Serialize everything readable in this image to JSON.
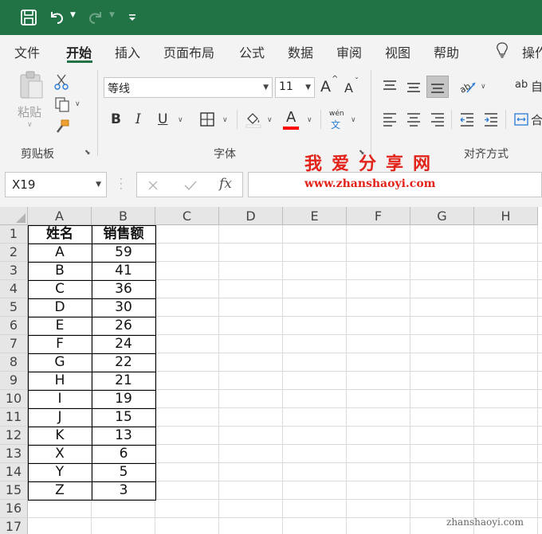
{
  "quick_access": {
    "icons": [
      "save-icon",
      "undo-icon",
      "redo-icon",
      "customize-qat-icon"
    ]
  },
  "ribbon_tabs": [
    "文件",
    "开始",
    "插入",
    "页面布局",
    "公式",
    "数据",
    "审阅",
    "视图",
    "帮助",
    "操作"
  ],
  "active_tab": "开始",
  "ribbon": {
    "clipboard": {
      "paste_label": "粘贴",
      "group_label": "剪贴板"
    },
    "font": {
      "font_name": "等线",
      "font_size": "11",
      "grow_label": "A",
      "shrink_label": "A",
      "bold": "B",
      "italic": "I",
      "underline": "U",
      "font_color_label": "A",
      "phonetic_top": "wén",
      "phonetic_bottom": "文",
      "group_label": "字体",
      "font_color": "#ff0000"
    },
    "alignment": {
      "wrap_label": "自",
      "merge_label": "合",
      "phonetic_ab": "ab",
      "group_label": "对齐方式"
    }
  },
  "formula_bar": {
    "name_box": "X19",
    "fx_label": "fx",
    "formula": ""
  },
  "watermark": {
    "title": "我爱分享网",
    "url": "www.zhanshaoyi.com",
    "footer": "zhanshaoyi.com"
  },
  "sheet": {
    "columns": [
      "A",
      "B",
      "C",
      "D",
      "E",
      "F",
      "G",
      "H"
    ],
    "rows": [
      "1",
      "2",
      "3",
      "4",
      "5",
      "6",
      "7",
      "8",
      "9",
      "10",
      "11",
      "12",
      "13",
      "14",
      "15",
      "16",
      "17"
    ],
    "table_headers": [
      "姓名",
      "销售额"
    ],
    "table_rows": [
      [
        "A",
        "59"
      ],
      [
        "B",
        "41"
      ],
      [
        "C",
        "36"
      ],
      [
        "D",
        "30"
      ],
      [
        "E",
        "26"
      ],
      [
        "F",
        "24"
      ],
      [
        "G",
        "22"
      ],
      [
        "H",
        "21"
      ],
      [
        "I",
        "19"
      ],
      [
        "J",
        "15"
      ],
      [
        "K",
        "13"
      ],
      [
        "X",
        "6"
      ],
      [
        "Y",
        "5"
      ],
      [
        "Z",
        "3"
      ]
    ]
  },
  "colors": {
    "title_bar": "#217346",
    "ribbon_bg": "#f3f3f3",
    "watermark": "#e2231a"
  }
}
